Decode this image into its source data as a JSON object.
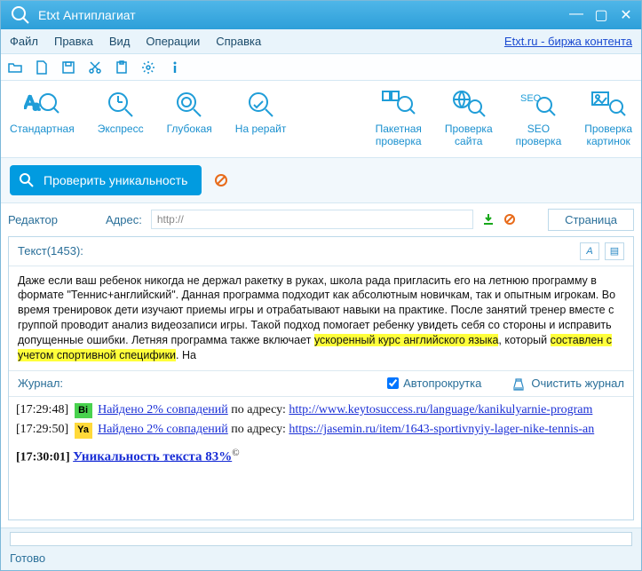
{
  "window": {
    "title": "Etxt Антиплагиат"
  },
  "menu": {
    "file": "Файл",
    "edit": "Правка",
    "view": "Вид",
    "ops": "Операции",
    "help": "Справка",
    "link": "Etxt.ru - биржа контента"
  },
  "ribbon": {
    "standard": "Стандартная",
    "express": "Экспресс",
    "deep": "Глубокая",
    "rewrite": "На рерайт",
    "batch": "Пакетная\nпроверка",
    "site": "Проверка\nсайта",
    "seo": "SEO\nпроверка",
    "images": "Проверка\nкартинок"
  },
  "action": {
    "check": "Проверить уникальность"
  },
  "addr": {
    "editor": "Редактор",
    "label": "Адрес:",
    "value": "http://",
    "tab": "Страница"
  },
  "text": {
    "header": "Текст(1453):",
    "body_plain_1": "Даже если ваш ребенок никогда не держал ракетку в руках, школа рада пригласить его на летнюю программу в формате \"Теннис+английский\". Данная программа подходит как абсолютным новичкам, так и опытным игрокам. Во время тренировок дети изучают приемы игры и отрабатывают навыки на практике. После занятий тренер вместе с группой проводит анализ видеозаписи игры. Такой подход помогает ребенку увидеть себя со стороны и исправить допущенные ошибки. Летняя программа также включает ",
    "body_hl_1": "ускоренный курс английского языка",
    "body_plain_2": ", который ",
    "body_hl_2": "составлен с учетом спортивной специфики",
    "body_plain_3": ". На"
  },
  "journal": {
    "header": "Журнал:",
    "autoscroll": "Автопрокрутка",
    "autoscroll_checked": true,
    "clear": "Очистить журнал",
    "rows": [
      {
        "ts": "[17:29:48]",
        "badge": "Bi",
        "badge_cls": "bi",
        "found": "Найдено 2% совпадений",
        "sep": " по адресу: ",
        "url": "http://www.keytosuccess.ru/language/kanikulyarnie-program"
      },
      {
        "ts": "[17:29:50]",
        "badge": "Ya",
        "badge_cls": "ya",
        "found": "Найдено 2% совпадений",
        "sep": " по адресу: ",
        "url": "https://jasemin.ru/item/1643-sportivnyiy-lager-nike-tennis-an"
      }
    ],
    "result_ts": "[17:30:01]",
    "result_text": "Уникальность текста 83%",
    "copy": "©"
  },
  "status": {
    "text": "Готово"
  }
}
